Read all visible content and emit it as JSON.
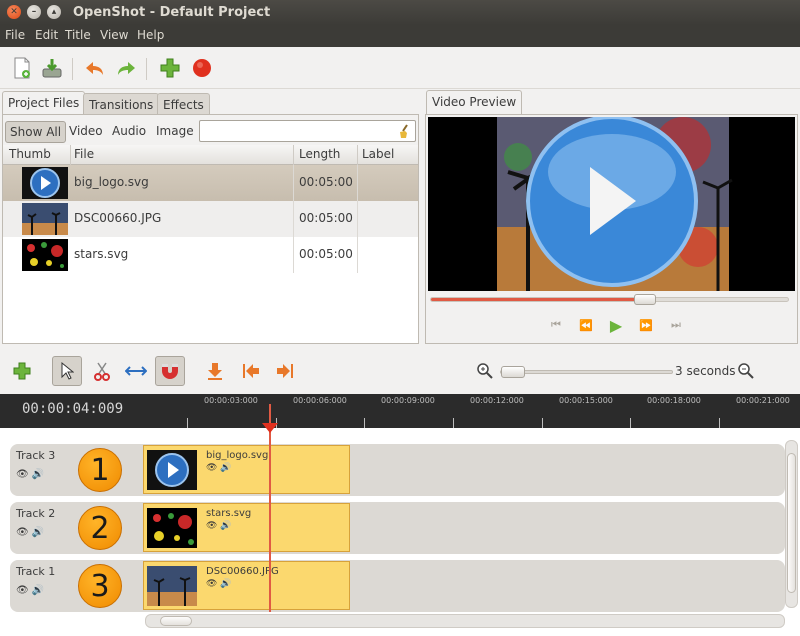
{
  "window": {
    "title": "OpenShot - Default Project"
  },
  "menu": [
    "File",
    "Edit",
    "Title",
    "View",
    "Help"
  ],
  "toolbar": {
    "icons": [
      "new-project-icon",
      "save-project-icon",
      "undo-icon",
      "redo-icon",
      "add-files-icon",
      "record-icon"
    ]
  },
  "tabs": [
    "Project Files",
    "Transitions",
    "Effects"
  ],
  "filters": [
    "Show All",
    "Video",
    "Audio",
    "Image"
  ],
  "search": {
    "value": "",
    "placeholder": ""
  },
  "table": {
    "headers": [
      "Thumb",
      "File",
      "Length",
      "Label"
    ],
    "rows": [
      {
        "file": "big_logo.svg",
        "length": "00:05:00",
        "label": ""
      },
      {
        "file": "DSC00660.JPG",
        "length": "00:05:00",
        "label": ""
      },
      {
        "file": "stars.svg",
        "length": "00:05:00",
        "label": ""
      }
    ]
  },
  "preview": {
    "tab": "Video Preview",
    "progress": 0.6
  },
  "timeline_toolbar": {
    "zoom_label": "3 seconds",
    "icons": [
      "add-track-icon",
      "select-tool-icon",
      "razor-icon",
      "resize-icon",
      "snapping-magnet-icon",
      "add-marker-icon",
      "previous-marker-icon",
      "next-marker-icon"
    ]
  },
  "ruler": {
    "timecode": "00:00:04:009",
    "ticks": [
      "00:00:03:000",
      "00:00:06:000",
      "00:00:09:000",
      "00:00:12:000",
      "00:00:15:000",
      "00:00:18:000",
      "00:00:21:000"
    ]
  },
  "tracks": [
    {
      "name": "Track 3",
      "number": "1",
      "clip": "big_logo.svg"
    },
    {
      "name": "Track 2",
      "number": "2",
      "clip": "stars.svg"
    },
    {
      "name": "Track 1",
      "number": "3",
      "clip": "DSC00660.JPG"
    }
  ],
  "colors": {
    "accent": "#e05a44",
    "clip": "#fbd86e",
    "selection": "#c7bdae",
    "badge": "#f08a00"
  }
}
